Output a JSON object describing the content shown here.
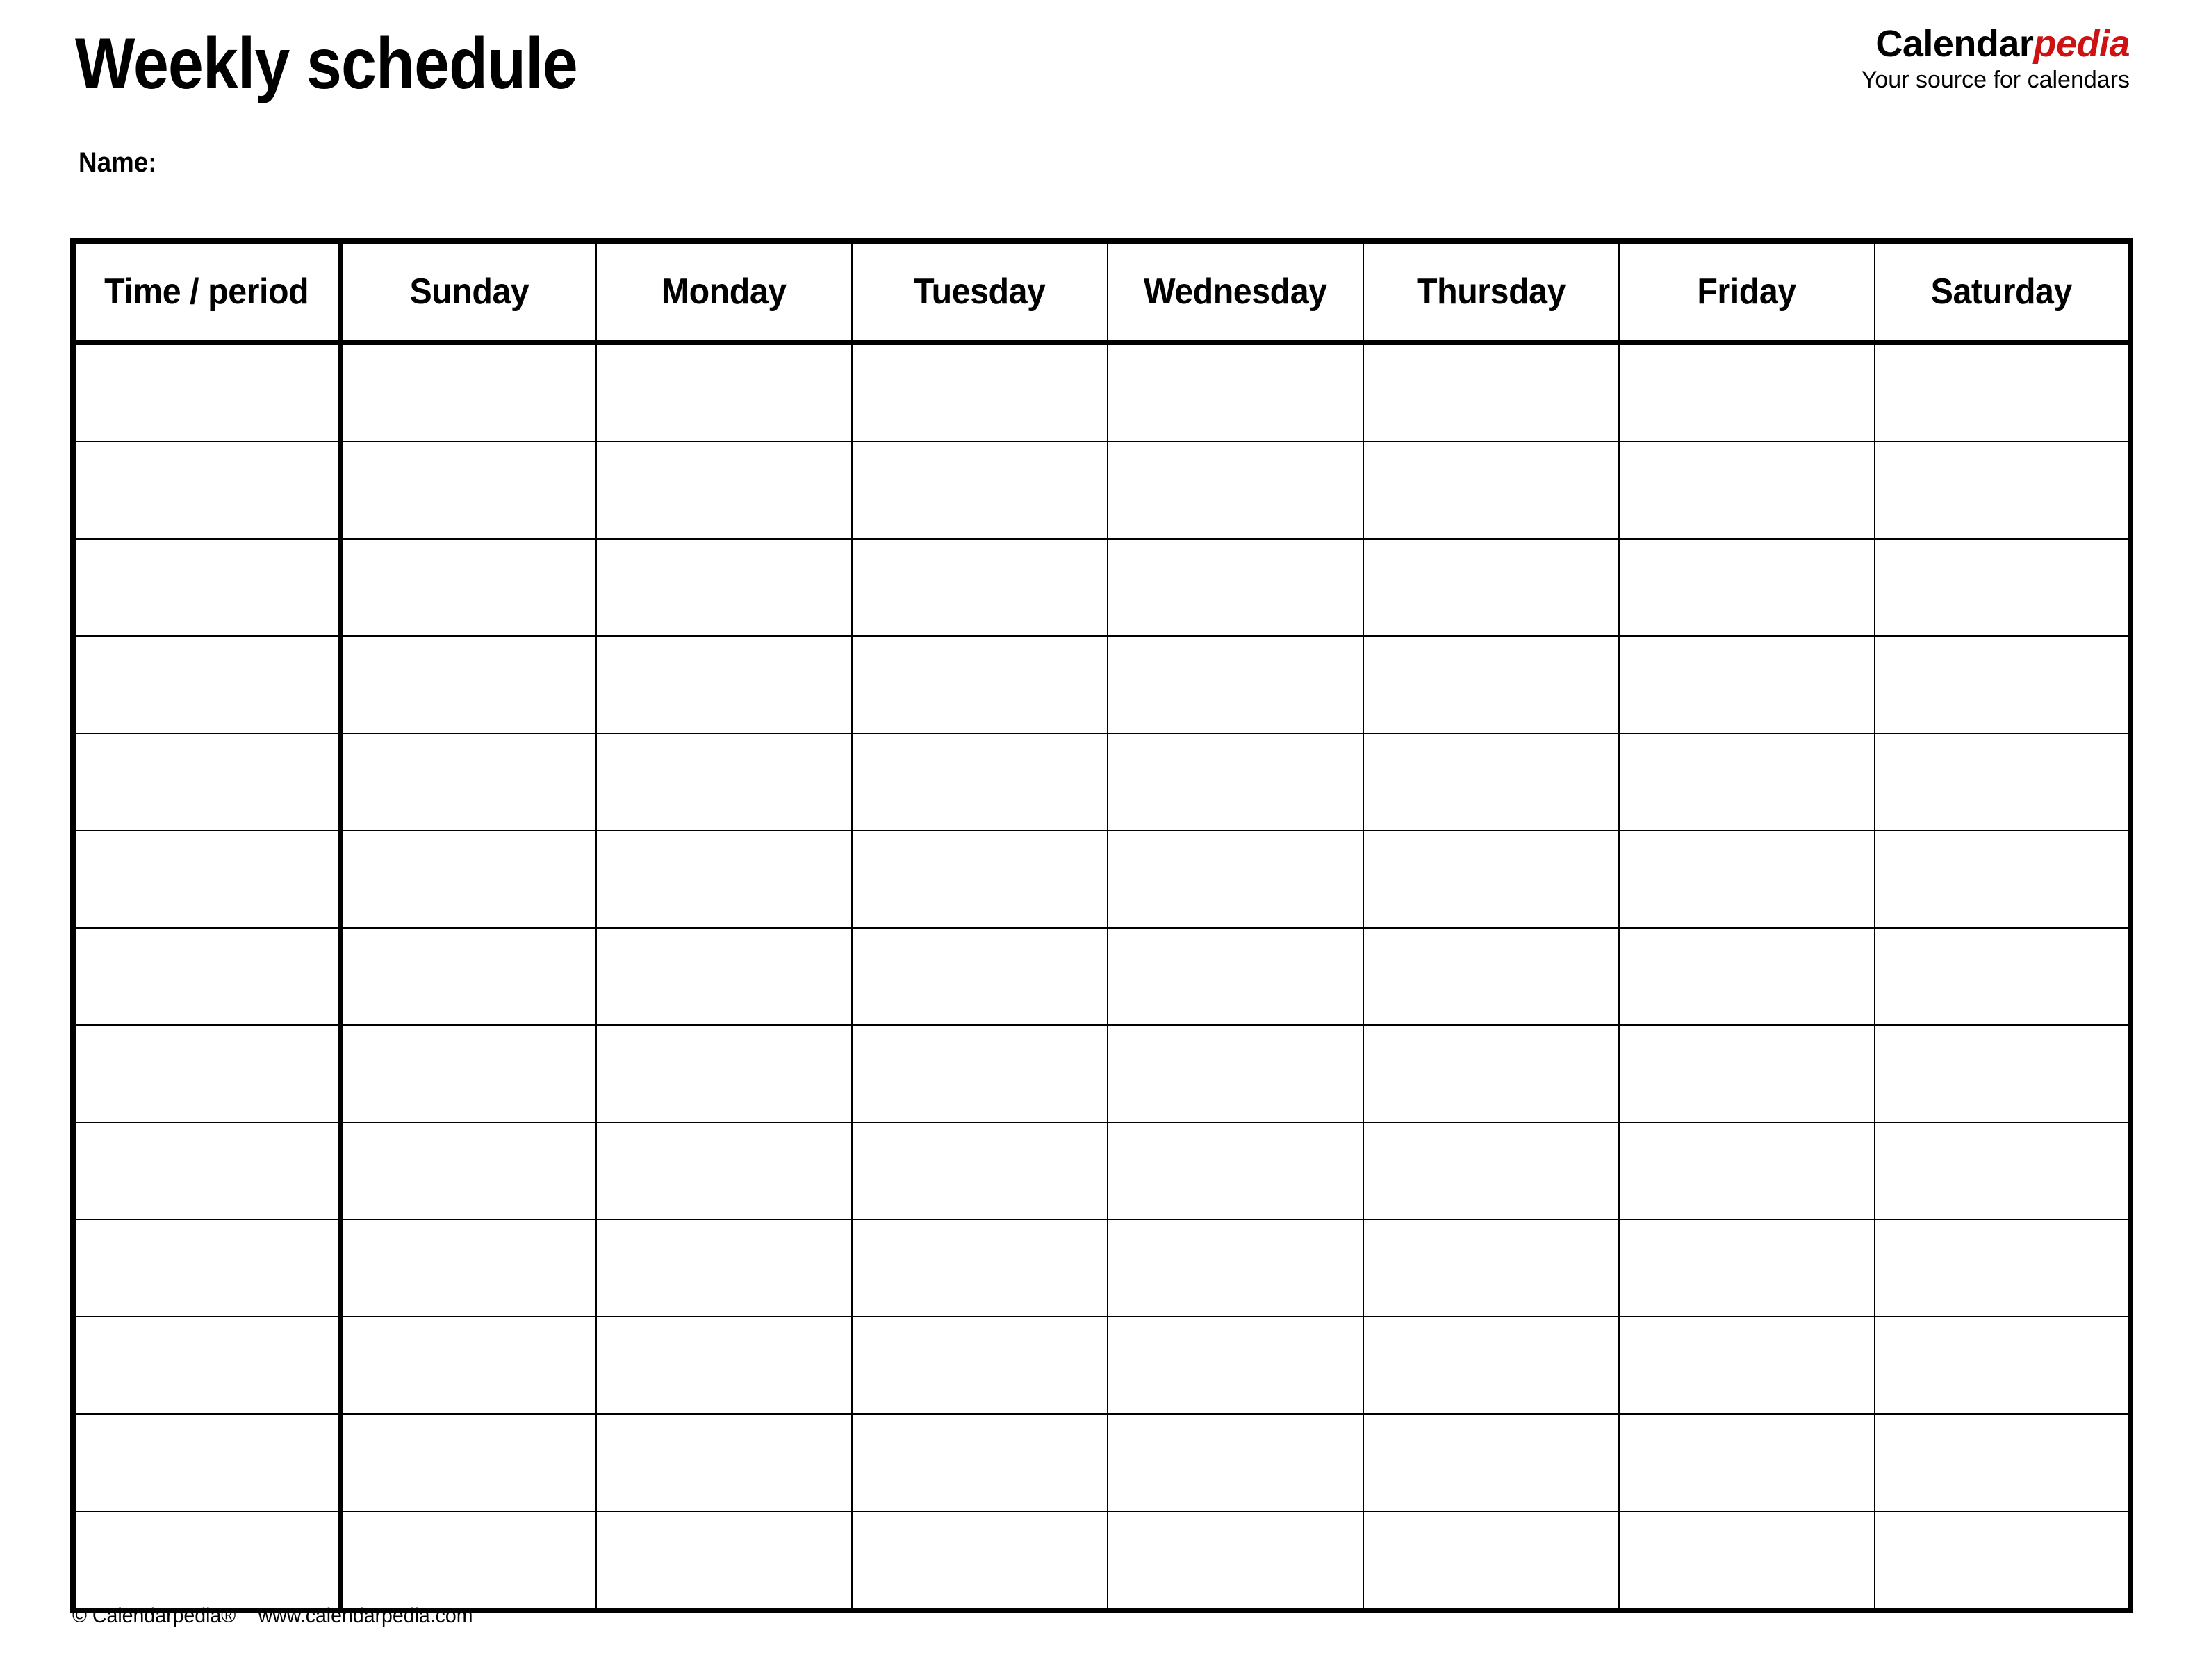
{
  "document": {
    "title": "Weekly schedule",
    "name_label": "Name:"
  },
  "brand": {
    "word_first": "Calendar",
    "word_second": "pedia",
    "tagline": "Your source for calendars",
    "accent_color": "#cc1212",
    "text_color": "#000000"
  },
  "table": {
    "columns": [
      "Time / period",
      "Sunday",
      "Monday",
      "Tuesday",
      "Wednesday",
      "Thursday",
      "Friday",
      "Saturday"
    ],
    "row_count": 13,
    "rows": [
      [
        "",
        "",
        "",
        "",
        "",
        "",
        "",
        ""
      ],
      [
        "",
        "",
        "",
        "",
        "",
        "",
        "",
        ""
      ],
      [
        "",
        "",
        "",
        "",
        "",
        "",
        "",
        ""
      ],
      [
        "",
        "",
        "",
        "",
        "",
        "",
        "",
        ""
      ],
      [
        "",
        "",
        "",
        "",
        "",
        "",
        "",
        ""
      ],
      [
        "",
        "",
        "",
        "",
        "",
        "",
        "",
        ""
      ],
      [
        "",
        "",
        "",
        "",
        "",
        "",
        "",
        ""
      ],
      [
        "",
        "",
        "",
        "",
        "",
        "",
        "",
        ""
      ],
      [
        "",
        "",
        "",
        "",
        "",
        "",
        "",
        ""
      ],
      [
        "",
        "",
        "",
        "",
        "",
        "",
        "",
        ""
      ],
      [
        "",
        "",
        "",
        "",
        "",
        "",
        "",
        ""
      ],
      [
        "",
        "",
        "",
        "",
        "",
        "",
        "",
        ""
      ],
      [
        "",
        "",
        "",
        "",
        "",
        "",
        "",
        ""
      ]
    ]
  },
  "footer": {
    "copyright": "© Calendarpedia®",
    "website": "www.calendarpedia.com"
  }
}
